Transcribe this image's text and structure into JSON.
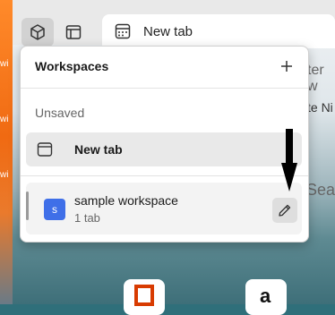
{
  "toolbar": {
    "tab_label": "New tab"
  },
  "right_peek": {
    "line1": "ter w",
    "line2": "te Ni",
    "line3": "Sear"
  },
  "wallpaper": {
    "t1": "wi",
    "t2": "wi",
    "t3": "wi"
  },
  "workspaces_panel": {
    "title": "Workspaces",
    "unsaved_section_label": "Unsaved",
    "unsaved_tab_label": "New tab",
    "workspace": {
      "avatar_letter": "s",
      "name": "sample workspace",
      "tab_count": "1 tab"
    }
  },
  "colors": {
    "accent_avatar": "#3f6fe8",
    "panel_bg": "#ffffff",
    "hover_row": "#e9e9e9"
  }
}
